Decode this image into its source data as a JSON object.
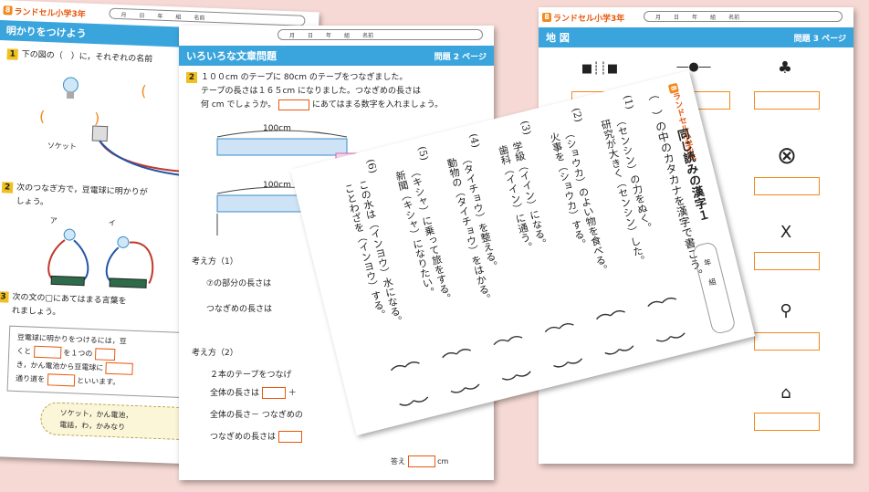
{
  "brand": "ランドセル小学3年",
  "date_fields": [
    "月",
    "日",
    "年",
    "組",
    "名前"
  ],
  "sheet_light": {
    "title": "明かりをつけよう",
    "q1": "下の図の（　）に，それぞれの名前",
    "socket_label": "ソケット",
    "q2_line1": "次のつなぎ方で，豆電球に明かりが",
    "q2_line2": "しょう。",
    "circuit_labels": [
      "ア",
      "イ"
    ],
    "q3_line1": "次の文の□にあてはまる言葉を",
    "q3_line2": "れましょう。",
    "box_lines": [
      "豆電球に明かりをつけるには，豆",
      "くと",
      "を１つの",
      "き，かん電池から豆電球に",
      "通り道を",
      "といいます。"
    ],
    "word_bank": [
      "ソケット，かん電池，",
      "電話，わ，かみなり"
    ]
  },
  "sheet_word": {
    "title": "いろいろな文章問題",
    "page": "問題 2 ページ",
    "q2_lines": [
      "１００cm のテープに 80cm のテープをつなぎました。",
      "テープの長さは１６５cm になりました。つなぎめの長さは",
      "何 cm でしょうか。",
      "にあてはまる数字を入れましょう。"
    ],
    "tape_label": "100cm",
    "think1": "考え方（1）",
    "part_length": "の部分の長さは",
    "joint_length": "つなぎめの長さは",
    "think2": "考え方（2）",
    "connect_line": "２本のテープをつなげ",
    "total_length": "全体の長さは",
    "minus_line": "全体の長さ－ つなぎめの",
    "joint_length2": "つなぎめの長さは",
    "answer_label": "答え",
    "answer_unit": "cm"
  },
  "sheet_map": {
    "title": "地 図",
    "page": "問題 3 ページ"
  },
  "sheet_kanji": {
    "title": "同じ読みの漢字１",
    "instruction": "（　）の中のカタカナを漢字で書こう。",
    "items": [
      {
        "n": "(1)",
        "lines": [
          "（センシン）の力をぬく。",
          "研究が大きく（センシン）した。"
        ]
      },
      {
        "n": "(2)",
        "lines": [
          "（ショウカ）のよい物を食べる。",
          "火事を（ショウカ）する。"
        ]
      },
      {
        "n": "(3)",
        "lines": [
          "学級（イイン）になる。",
          "歯科（イイン）に通う。"
        ]
      },
      {
        "n": "(4)",
        "lines": [
          "（タイチョウ）を整える。",
          "動物の（タイチョウ）をはかる。"
        ]
      },
      {
        "n": "(5)",
        "lines": [
          "（キシャ）に乗って旅をする。",
          "新聞（キシャ）になりたい。"
        ]
      },
      {
        "n": "(6)",
        "lines": [
          "この水は（インヨウ）水になる。",
          "ことわざを（インヨウ）する。"
        ]
      }
    ],
    "name_labels": [
      "年",
      "組"
    ]
  }
}
